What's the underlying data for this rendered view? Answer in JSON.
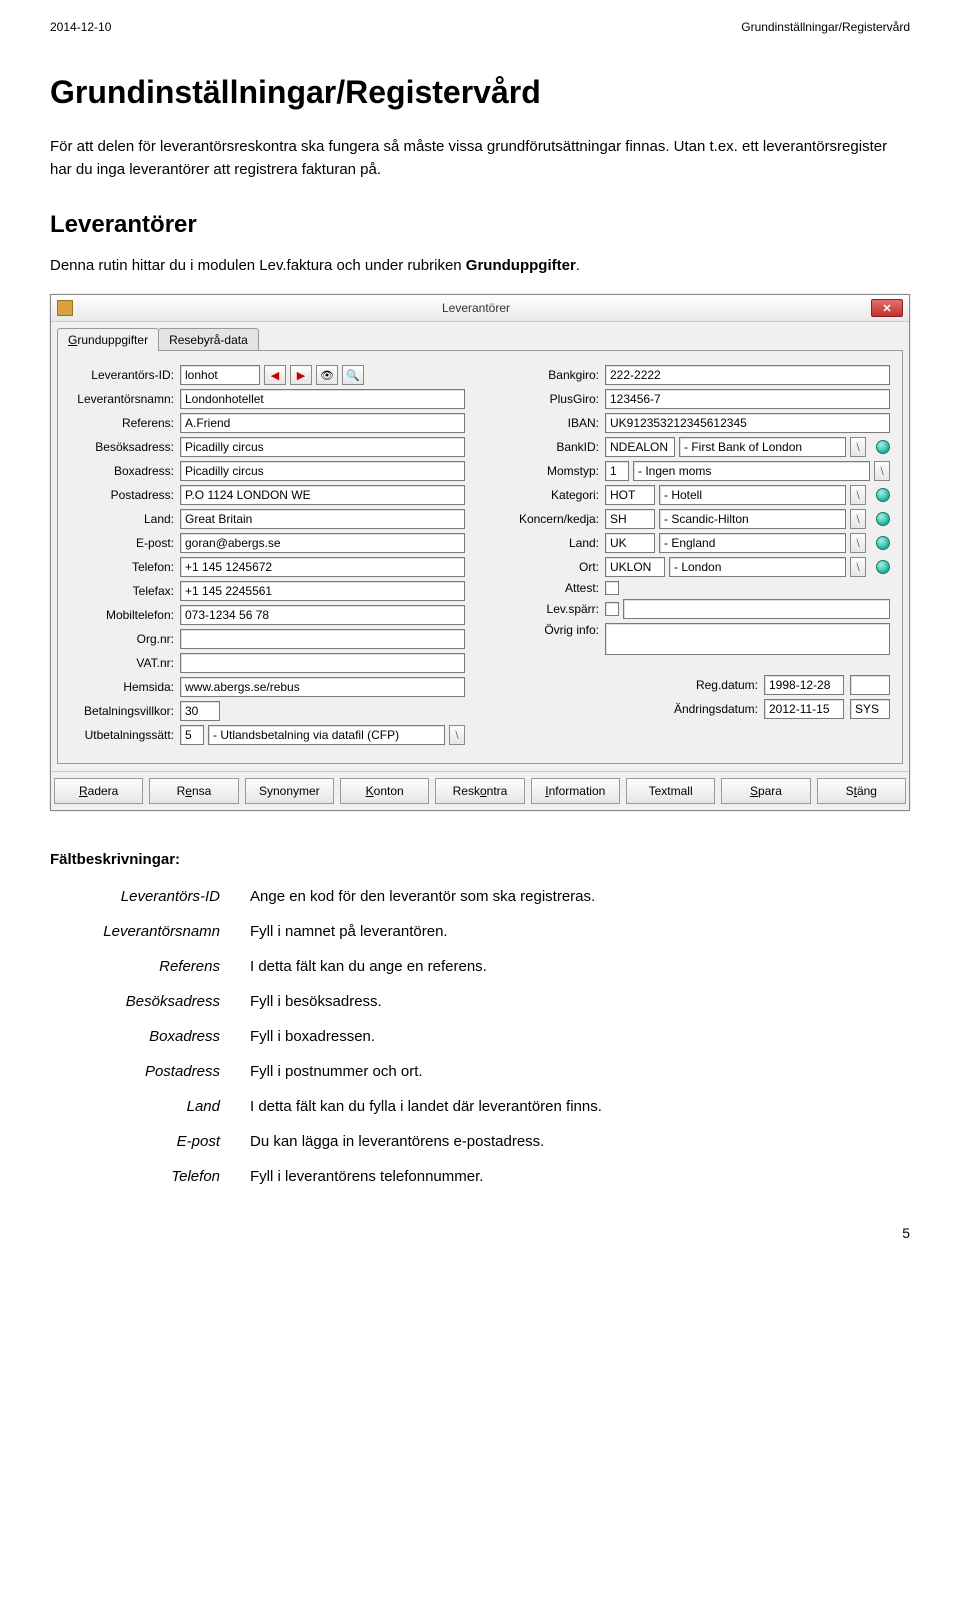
{
  "header": {
    "date": "2014-12-10",
    "doc_title": "Grundinställningar/Registervård"
  },
  "page": {
    "h1": "Grundinställningar/Registervård",
    "intro": "För att delen för leverantörsreskontra ska fungera så måste vissa grundförutsättningar finnas. Utan t.ex. ett leverantörsregister har du inga leverantörer att registrera fakturan på.",
    "h2": "Leverantörer",
    "sub": "Denna rutin hittar du i modulen Lev.faktura och under rubriken Grunduppgifter."
  },
  "window": {
    "title": "Leverantörer",
    "tabs": {
      "t1": "Grunduppgifter",
      "t1_key": "G",
      "t2": "Resebyrå-data"
    },
    "left": {
      "lev_id_lbl": "Leverantörs-ID:",
      "lev_id_val": "lonhot",
      "lev_namn_lbl": "Leverantörsnamn:",
      "lev_namn_val": "Londonhotellet",
      "referens_lbl": "Referens:",
      "referens_val": "A.Friend",
      "besok_lbl": "Besöksadress:",
      "besok_val": "Picadilly circus",
      "box_lbl": "Boxadress:",
      "box_val": "Picadilly circus",
      "post_lbl": "Postadress:",
      "post_val": "P.O 1124 LONDON WE",
      "land_lbl": "Land:",
      "land_val": "Great Britain",
      "epost_lbl": "E-post:",
      "epost_val": "goran@abergs.se",
      "tel_lbl": "Telefon:",
      "tel_val": "+1 145 1245672",
      "fax_lbl": "Telefax:",
      "fax_val": "+1 145 2245561",
      "mob_lbl": "Mobiltelefon:",
      "mob_val": "073-1234 56 78",
      "org_lbl": "Org.nr:",
      "org_val": "",
      "vat_lbl": "VAT.nr:",
      "vat_val": "",
      "hems_lbl": "Hemsida:",
      "hems_val": "www.abergs.se/rebus",
      "betv_lbl": "Betalningsvillkor:",
      "betv_val": "30",
      "utb_lbl": "Utbetalningssätt:",
      "utb_code": "5",
      "utb_rest": "- Utlandsbetalning via datafil (CFP)"
    },
    "right": {
      "bg_lbl": "Bankgiro:",
      "bg_val": "222-2222",
      "pg_lbl": "PlusGiro:",
      "pg_val": "123456-7",
      "iban_lbl": "IBAN:",
      "iban_val": "UK912353212345612345",
      "bankid_lbl": "BankID:",
      "bankid_code": "NDEALON",
      "bankid_rest": "- First Bank of London",
      "moms_lbl": "Momstyp:",
      "moms_code": "1",
      "moms_rest": "- Ingen moms",
      "kat_lbl": "Kategori:",
      "kat_code": "HOT",
      "kat_rest": "- Hotell",
      "konc_lbl": "Koncern/kedja:",
      "konc_code": "SH",
      "konc_rest": "- Scandic-Hilton",
      "land_lbl": "Land:",
      "land_code": "UK",
      "land_rest": "- England",
      "ort_lbl": "Ort:",
      "ort_code": "UKLON",
      "ort_rest": "- London",
      "attest_lbl": "Attest:",
      "sparr_lbl": "Lev.spärr:",
      "ovrig_lbl": "Övrig info:",
      "ovrig_val": "",
      "regdatum_lbl": "Reg.datum:",
      "regdatum_val": "1998-12-28",
      "andring_lbl": "Ändringsdatum:",
      "andring_val": "2012-11-15",
      "andring_sig": "SYS"
    },
    "buttons": {
      "radera": "Radera",
      "r": "R",
      "rensa": "Rensa",
      "e": "e",
      "synonymer": "Synonymer",
      "konton": "Konton",
      "k": "K",
      "reskontra": "Reskontra",
      "o": "o",
      "information": "Information",
      "i": "I",
      "textmall": "Textmall",
      "spara": "Spara",
      "s": "S",
      "stang": "Stäng",
      "t": "t"
    }
  },
  "fdesc": {
    "title": "Fältbeskrivningar:",
    "rows": [
      {
        "term": "Leverantörs-ID",
        "def": "Ange en kod för den leverantör som ska registreras."
      },
      {
        "term": "Leverantörsnamn",
        "def": "Fyll i namnet på leverantören."
      },
      {
        "term": "Referens",
        "def": "I detta fält kan du ange en referens."
      },
      {
        "term": "Besöksadress",
        "def": "Fyll i besöksadress."
      },
      {
        "term": "Boxadress",
        "def": "Fyll i boxadressen."
      },
      {
        "term": "Postadress",
        "def": "Fyll i postnummer och ort."
      },
      {
        "term": "Land",
        "def": "I detta fält kan du fylla i landet där leverantören finns."
      },
      {
        "term": "E-post",
        "def": "Du kan lägga in leverantörens e-postadress."
      },
      {
        "term": "Telefon",
        "def": "Fyll i leverantörens telefonnummer."
      }
    ]
  },
  "page_num": "5"
}
